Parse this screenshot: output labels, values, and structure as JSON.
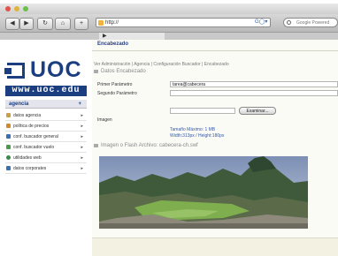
{
  "toolbar": {
    "back_label": "◀",
    "forward_label": "▶",
    "reload_label": "↻",
    "home_label": "⌂",
    "bookmark_label": "+",
    "address_value": "http://",
    "address_tools": "G◯▾",
    "search_placeholder": "Google Powered"
  },
  "tabs": [
    {
      "label": "▶"
    }
  ],
  "sidebar": {
    "logo_text": "UOC",
    "url_badge": "www.uoc.edu",
    "menu_header": "agencia",
    "menu_header_plus": "+",
    "items": [
      {
        "label": "datos agencia",
        "icon": "file-icon",
        "color": "#c8a048"
      },
      {
        "label": "política de precios",
        "icon": "shield-icon",
        "color": "#d08a2a"
      },
      {
        "label": "conf. buscador general",
        "icon": "gear-icon",
        "color": "#3a6fb0"
      },
      {
        "label": "conf. buscador vuelo",
        "icon": "gear-icon",
        "color": "#4a9a4a"
      },
      {
        "label": "utilidades web",
        "icon": "globe-icon",
        "color": "#3a8a4a"
      },
      {
        "label": "datos corporates",
        "icon": "people-icon",
        "color": "#3a6fb0"
      }
    ],
    "item_arrow": "▸"
  },
  "main": {
    "title": "Encabezado",
    "breadcrumb": "Ver Administración | Agencia | Configuración Buscador | Encabezado",
    "section1": "Datos Encabezado",
    "fields": {
      "primer_label": "Primer Parámetro",
      "primer_value": "tarea@cabecera",
      "segundo_label": "Segundo Parámetro",
      "segundo_value": "",
      "imagen_label": "Imagen",
      "browse_label": "Examinar..."
    },
    "image_info": {
      "size": "Tamaño Máximo: 1 MB",
      "dims": "Width:313px / Height:180px"
    },
    "section2": "Imagen o Flash Archivo: cabecera-ch.swf"
  },
  "colors": {
    "brand": "#1a3e80",
    "accent": "#3559a8"
  }
}
